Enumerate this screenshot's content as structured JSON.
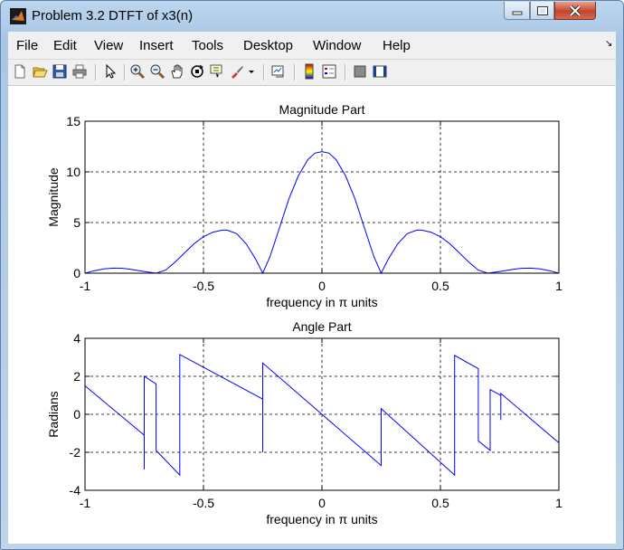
{
  "window": {
    "title": "Problem 3.2 DTFT of x3(n)",
    "app_icon": "matlab-icon",
    "controls": [
      "minimize-icon",
      "maximize-icon",
      "close-icon"
    ]
  },
  "menubar": {
    "items": [
      "File",
      "Edit",
      "View",
      "Insert",
      "Tools",
      "Desktop",
      "Window",
      "Help"
    ],
    "overflow_icon": "dock-arrow-icon"
  },
  "toolbar": {
    "icons": [
      "new-figure-icon",
      "open-file-icon",
      "save-icon",
      "print-icon",
      "edit-plot-arrow-icon",
      "zoom-in-icon",
      "zoom-out-icon",
      "pan-hand-icon",
      "rotate-3d-icon",
      "data-cursor-icon",
      "brush-icon",
      "brush-dropdown-icon",
      "link-plot-icon",
      "insert-colorbar-icon",
      "insert-legend-icon",
      "hide-plot-tools-icon",
      "show-plot-tools-icon"
    ]
  },
  "chart_data": [
    {
      "type": "line",
      "title": "Magnitude Part",
      "xlabel": "frequency in π units",
      "ylabel": "Magnitude",
      "xlim": [
        -1,
        1
      ],
      "ylim": [
        0,
        15
      ],
      "xticks": [
        -1,
        -0.5,
        0,
        0.5,
        1
      ],
      "yticks": [
        0,
        5,
        10,
        15
      ],
      "xtick_labels": [
        "-1",
        "-0.5",
        "0",
        "0.5",
        "1"
      ],
      "ytick_labels": [
        "0",
        "5",
        "10",
        "15"
      ],
      "grid": true,
      "color": "#0000ff",
      "series": [
        {
          "x": [
            -1.0,
            -0.96,
            -0.92,
            -0.88,
            -0.84,
            -0.8,
            -0.76,
            -0.72,
            -0.7,
            -0.66,
            -0.62,
            -0.58,
            -0.54,
            -0.5,
            -0.46,
            -0.42,
            -0.4,
            -0.36,
            -0.32,
            -0.28,
            -0.25,
            -0.22,
            -0.18,
            -0.14,
            -0.1,
            -0.06,
            -0.03,
            0.0,
            0.03,
            0.06,
            0.1,
            0.14,
            0.18,
            0.22,
            0.25,
            0.28,
            0.32,
            0.36,
            0.4,
            0.42,
            0.46,
            0.5,
            0.54,
            0.58,
            0.62,
            0.66,
            0.7,
            0.72,
            0.76,
            0.8,
            0.84,
            0.88,
            0.92,
            0.96,
            1.0
          ],
          "y": [
            0.0,
            0.25,
            0.42,
            0.5,
            0.48,
            0.36,
            0.2,
            0.06,
            0.0,
            0.3,
            1.1,
            2.0,
            2.9,
            3.6,
            4.05,
            4.25,
            4.25,
            3.9,
            2.9,
            1.4,
            0.0,
            1.6,
            4.4,
            7.3,
            9.6,
            11.2,
            11.85,
            12.0,
            11.85,
            11.2,
            9.6,
            7.3,
            4.4,
            1.6,
            0.0,
            1.4,
            2.9,
            3.9,
            4.25,
            4.25,
            4.05,
            3.6,
            2.9,
            2.0,
            1.1,
            0.3,
            0.0,
            0.06,
            0.2,
            0.36,
            0.48,
            0.5,
            0.42,
            0.25,
            0.0
          ]
        }
      ]
    },
    {
      "type": "line",
      "title": "Angle Part",
      "xlabel": "frequency in π units",
      "ylabel": "Radians",
      "xlim": [
        -1,
        1
      ],
      "ylim": [
        -4,
        4
      ],
      "xticks": [
        -1,
        -0.5,
        0,
        0.5,
        1
      ],
      "yticks": [
        -4,
        -2,
        0,
        2,
        4
      ],
      "xtick_labels": [
        "-1",
        "-0.5",
        "0",
        "0.5",
        "1"
      ],
      "ytick_labels": [
        "-4",
        "-2",
        "0",
        "2",
        "4"
      ],
      "grid": true,
      "color": "#0000ff",
      "series": [
        {
          "x": [
            -1.0,
            -0.75,
            -0.75,
            -0.75,
            -0.75,
            -0.7,
            -0.7,
            -0.6,
            -0.6,
            -0.25,
            -0.25,
            -0.25,
            -0.25,
            0.0,
            0.25,
            0.25,
            0.25,
            0.25,
            0.56,
            0.56,
            0.66,
            0.66,
            0.71,
            0.71,
            0.755,
            0.755,
            0.755,
            0.755,
            1.0,
            1.0
          ],
          "y": [
            1.5,
            -1.1,
            -1.9,
            -2.9,
            2.0,
            1.6,
            -1.9,
            -3.2,
            3.15,
            0.8,
            0.0,
            -2.0,
            2.7,
            0.0,
            -2.7,
            -2.0,
            0.0,
            0.3,
            -3.2,
            3.1,
            2.4,
            -1.4,
            -1.9,
            1.3,
            1.0,
            0.0,
            -0.3,
            1.1,
            -1.5,
            -0.8
          ]
        }
      ]
    }
  ]
}
